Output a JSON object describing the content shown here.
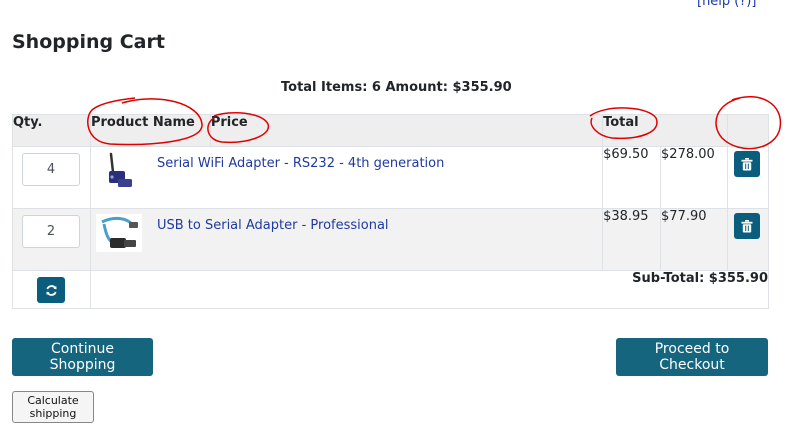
{
  "header": {
    "help_link": "[help (?)]",
    "title": "Shopping Cart"
  },
  "summary": {
    "line": "Total Items: 6  Amount: $355.90"
  },
  "table": {
    "columns": [
      "Qty.",
      "Product Name",
      "Price",
      "Total",
      ""
    ],
    "rows": [
      {
        "qty": "4",
        "product": "Serial WiFi Adapter - RS232 - 4th generation",
        "thumb": "wifi-adapter-image",
        "price": "$69.50",
        "total": "$278.00",
        "delete_icon": "trash-icon"
      },
      {
        "qty": "2",
        "product": "USB to Serial Adapter - Professional",
        "thumb": "usb-serial-cable-image",
        "price": "$38.95",
        "total": "$77.90",
        "delete_icon": "trash-icon"
      }
    ],
    "update_icon": "refresh-icon",
    "subtotal": "Sub-Total: $355.90"
  },
  "buttons": {
    "continue": "Continue Shopping",
    "checkout": "Proceed to Checkout",
    "shipping": "Calculate shipping"
  },
  "colors": {
    "button": "#15657f",
    "icon_button": "#0a5d7d",
    "link": "#1f3a9e",
    "annotation": "#e00000"
  }
}
